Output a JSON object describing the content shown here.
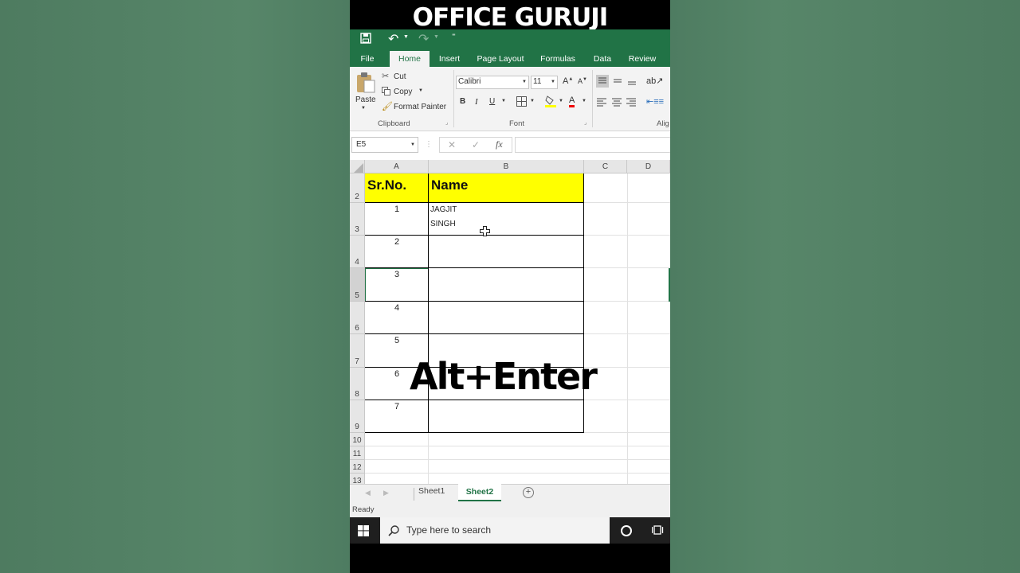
{
  "banner": "OFFICE GURUJI",
  "ribbon_tabs": [
    "File",
    "Home",
    "Insert",
    "Page Layout",
    "Formulas",
    "Data",
    "Review"
  ],
  "active_tab": "Home",
  "clipboard": {
    "paste": "Paste",
    "cut": "Cut",
    "copy": "Copy",
    "format_painter": "Format Painter",
    "group": "Clipboard"
  },
  "font": {
    "family": "Calibri",
    "size": "11",
    "bold": "B",
    "italic": "I",
    "underline": "U",
    "color_letter": "A",
    "group": "Font"
  },
  "alignment_group": "Alig",
  "name_box": "E5",
  "fx": "fx",
  "columns": [
    "A",
    "B",
    "C",
    "D"
  ],
  "rows": [
    "2",
    "3",
    "4",
    "5",
    "6",
    "7",
    "8",
    "9",
    "10",
    "11",
    "12",
    "13"
  ],
  "table": {
    "header_a": "Sr.No.",
    "header_b": "Name",
    "serials": [
      "1",
      "2",
      "3",
      "4",
      "5",
      "6",
      "7"
    ],
    "name_line1": "JAGJIT",
    "name_line2": "SINGH"
  },
  "overlay_text": "Alt+Enter",
  "sheets": [
    "Sheet1",
    "Sheet2"
  ],
  "active_sheet": "Sheet2",
  "status": "Ready",
  "taskbar": {
    "search_placeholder": "Type here to search"
  },
  "colors": {
    "excel_green": "#217346",
    "header_fill": "#ffff00",
    "background": "#4f7f62"
  }
}
